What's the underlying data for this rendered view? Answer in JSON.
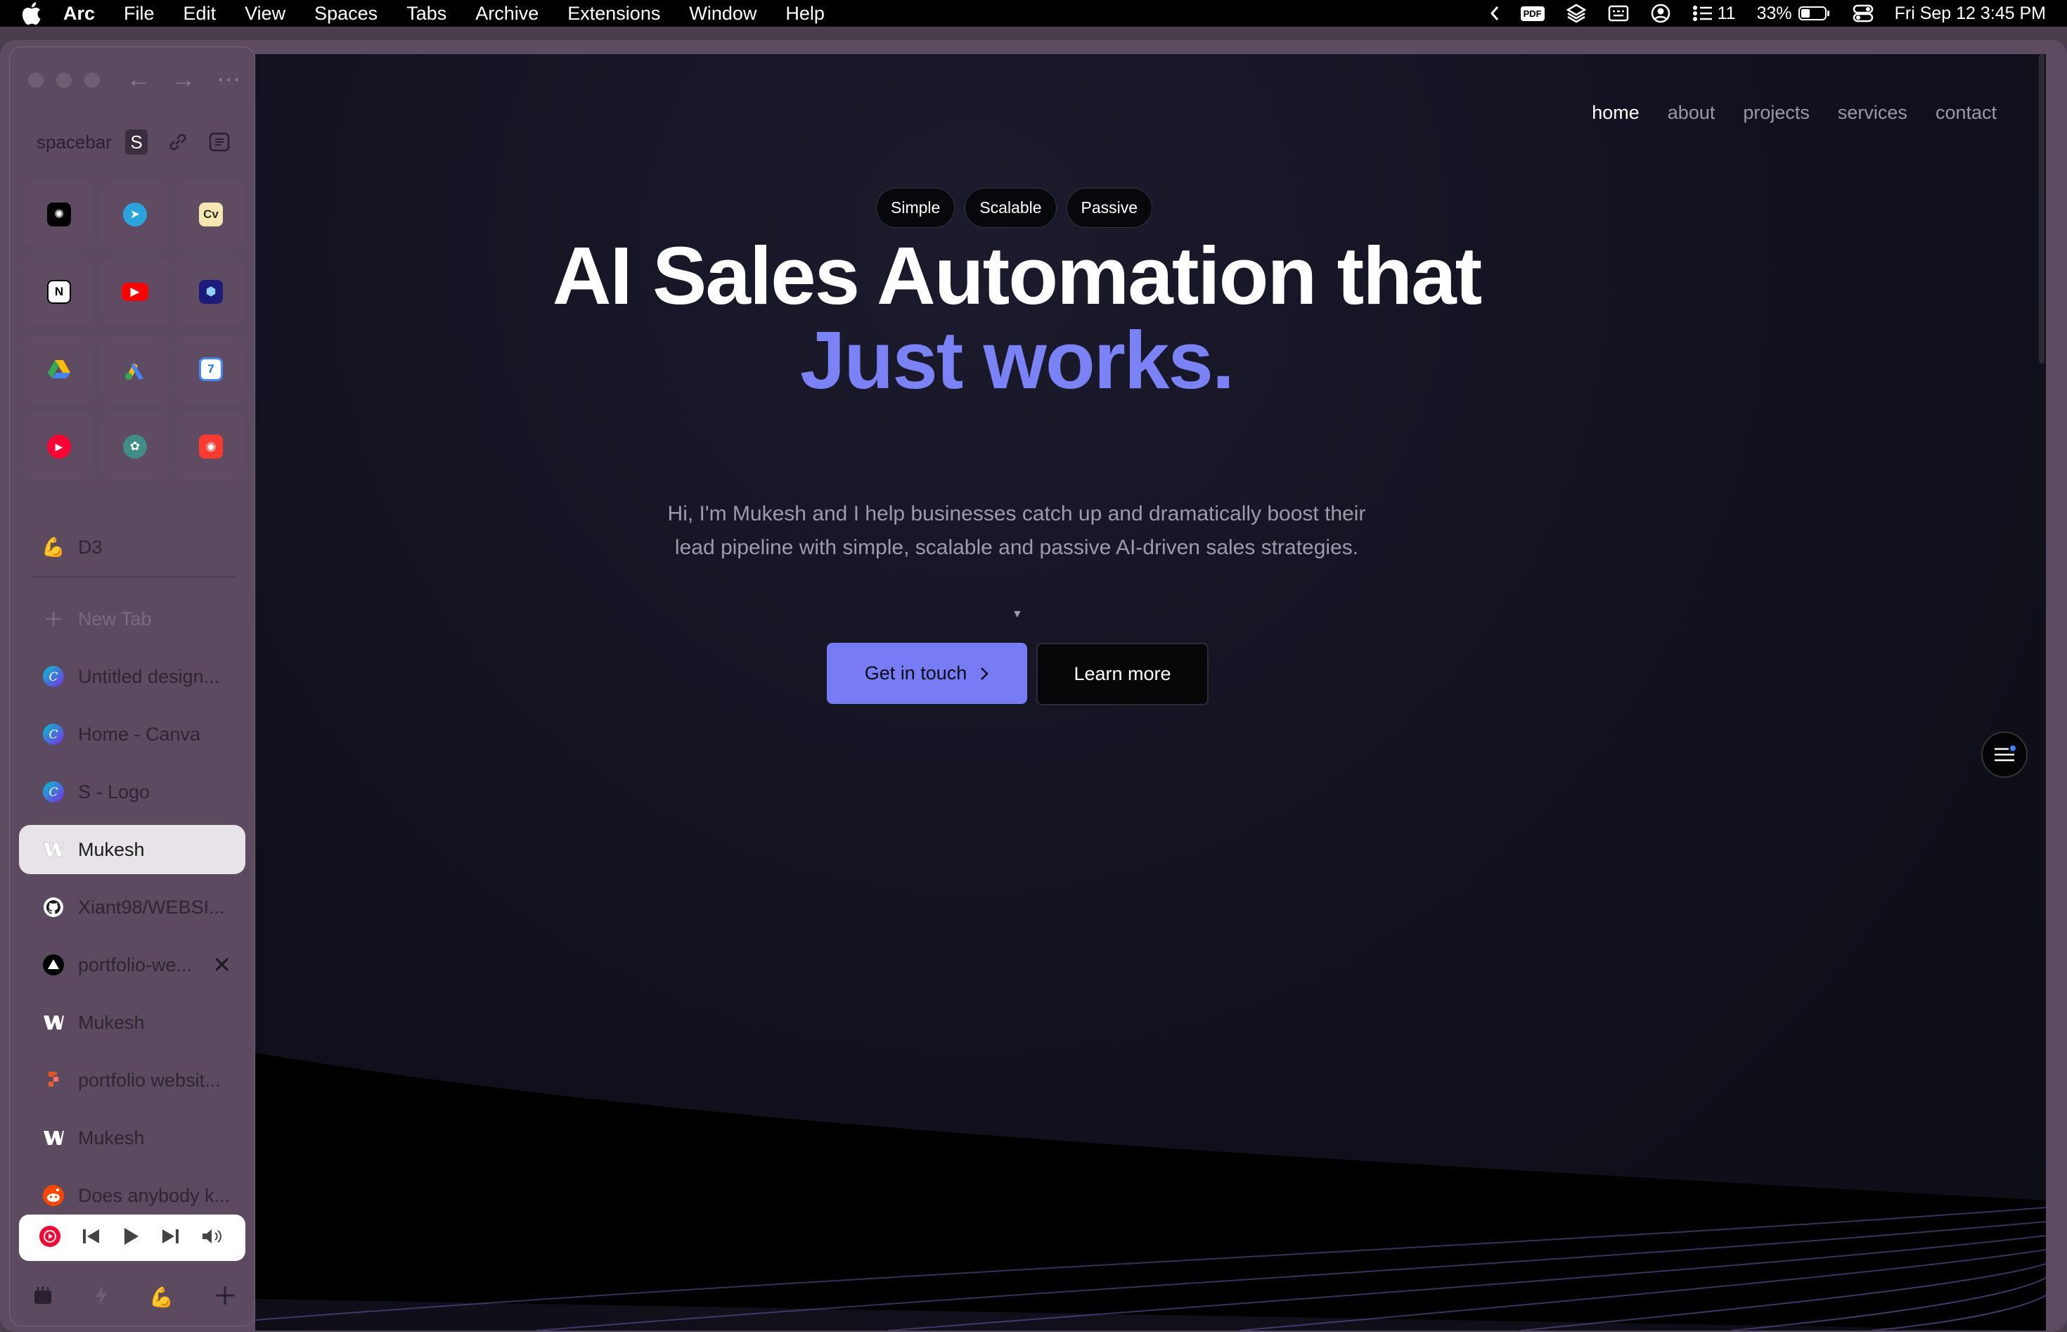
{
  "menubar": {
    "app": "Arc",
    "items": [
      "File",
      "Edit",
      "View",
      "Spaces",
      "Tabs",
      "Archive",
      "Extensions",
      "Window",
      "Help"
    ],
    "pdf_label": "PDF",
    "list_count": "11",
    "battery": "33%",
    "datetime": "Fri Sep 12  3:45 PM"
  },
  "sidebar": {
    "space_name": "spacebar",
    "space_badge": "S",
    "favorites": [
      {
        "name": "ai-app-icon",
        "bg": "#000000",
        "fg": "#ffffff",
        "glyph": "✺"
      },
      {
        "name": "telegram-icon",
        "bg": "#2aa3df",
        "fg": "#ffffff",
        "glyph": "➤"
      },
      {
        "name": "cv-icon",
        "bg": "#f6e6b0",
        "fg": "#2a2a2a",
        "glyph": "Cv"
      },
      {
        "name": "notion-icon",
        "bg": "#ffffff",
        "fg": "#000000",
        "glyph": "N"
      },
      {
        "name": "youtube-icon",
        "bg": "#ff0000",
        "fg": "#ffffff",
        "glyph": "▶"
      },
      {
        "name": "cube-app-icon",
        "bg": "#1c1a7a",
        "fg": "#8fd0ff",
        "glyph": "⬢"
      },
      {
        "name": "google-drive-icon",
        "bg": "transparent",
        "fg": "#34a853",
        "glyph": "▲"
      },
      {
        "name": "google-ads-icon",
        "bg": "transparent",
        "fg": "#fbbc04",
        "glyph": "◆"
      },
      {
        "name": "google-calendar-icon",
        "bg": "#ffffff",
        "fg": "#1a73e8",
        "glyph": "7"
      },
      {
        "name": "youtube-music-icon",
        "bg": "#ff0033",
        "fg": "#ffffff",
        "glyph": "▶"
      },
      {
        "name": "chatgpt-icon",
        "bg": "#3f8d85",
        "fg": "#ffffff",
        "glyph": "✿"
      },
      {
        "name": "screen-recorder-icon",
        "bg": "#ff3b30",
        "fg": "#ffffff",
        "glyph": "◉"
      }
    ],
    "pinned": [
      {
        "label": "D3",
        "name": "flexed-biceps-icon",
        "glyph": "💪"
      }
    ],
    "new_tab": "New Tab",
    "tabs": [
      {
        "label": "Untitled design...",
        "icon": "canva-icon",
        "active": false
      },
      {
        "label": "Home - Canva",
        "icon": "canva-icon",
        "active": false
      },
      {
        "label": "S - Logo",
        "icon": "canva-icon",
        "active": false
      },
      {
        "label": "Mukesh",
        "icon": "webflow-icon",
        "active": true
      },
      {
        "label": "Xiant98/WEBSI...",
        "icon": "github-icon",
        "active": false
      },
      {
        "label": "portfolio-we...",
        "icon": "vercel-icon",
        "active": false,
        "close": "✕"
      },
      {
        "label": "Mukesh",
        "icon": "webflow-icon",
        "active": false
      },
      {
        "label": "portfolio websit...",
        "icon": "figma-icon",
        "active": false
      },
      {
        "label": "Mukesh",
        "icon": "webflow-icon",
        "active": false
      },
      {
        "label": "Does anybody k...",
        "icon": "reddit-icon",
        "active": false
      }
    ]
  },
  "site": {
    "nav": [
      "home",
      "about",
      "projects",
      "services",
      "contact"
    ],
    "pills": [
      "Simple",
      "Scalable",
      "Passive"
    ],
    "headline_1": "AI Sales Automation that",
    "headline_2": "Just works.",
    "subtext": "Hi, I'm Mukesh and I help businesses catch up and dramatically boost their lead pipeline with simple, scalable and passive AI-driven sales strategies.",
    "cta_primary": "Get in touch",
    "cta_secondary": "Learn more",
    "accent_color": "#777cf4"
  }
}
